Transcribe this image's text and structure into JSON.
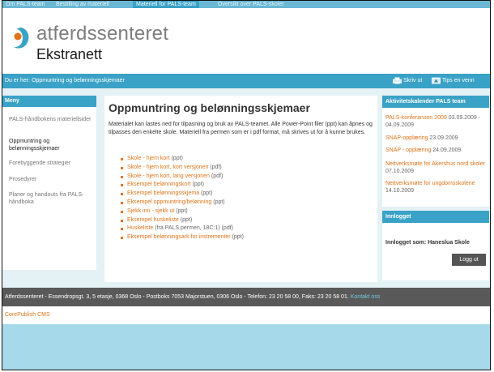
{
  "topnav": {
    "items": [
      {
        "label": "Om PALS-team"
      },
      {
        "label": "Bestilling av materiell"
      },
      {
        "label": "Materiell for PALS-team"
      },
      {
        "label": "Oversikt over PALS-skoler"
      }
    ]
  },
  "header": {
    "brand": "atferdssenteret",
    "subtitle": "Ekstranett"
  },
  "breadcrumb": {
    "prefix": "Du er her: ",
    "link": "Oppmuntring og belønningsskjemaer"
  },
  "tools": {
    "print_label": "Skriv ut",
    "tip_label": "Tips en venn"
  },
  "sidebar": {
    "heading": "Meny",
    "items": [
      {
        "label": "PALS-håndbokens materiellsider"
      },
      {
        "label": "Oppmuntring og belønningsskjemaer"
      },
      {
        "label": "Forebyggende strategier"
      },
      {
        "label": "Prosedyrer"
      },
      {
        "label": "Planer og handouts fra PALS-håndboka"
      }
    ]
  },
  "main": {
    "title": "Oppmuntring og belønningsskjemaer",
    "intro": "Materialet kan lastes ned for tilpasning og bruk av PALS-teamet. Alle Power-Point filer (ppt) kan åpnes og tilpasses den enkelte skole. Materiell fra permen som er i pdf format, må skrives ut for å kunne brukes.",
    "links": [
      {
        "text": "Skole - hjem kort",
        "suffix": " (ppt)"
      },
      {
        "text": "Skole - hjem kort, kort versjonen",
        "suffix": " (pdf)"
      },
      {
        "text": "Skole - hjem kort, lang versjonen",
        "suffix": " (pdf)"
      },
      {
        "text": "Eksempel belønningskort",
        "suffix": " (ppt)"
      },
      {
        "text": "Eksempel belønningsskjema",
        "suffix": " (ppt)"
      },
      {
        "text": "Eksempel oppmuntring/belønning",
        "suffix": " (ppt)"
      },
      {
        "text": "Sjekk inn - sjekk ut",
        "suffix": " (ppt)"
      },
      {
        "text": "Eksempel huskeliste",
        "suffix": " (ppt)"
      },
      {
        "text": "Huskeliste",
        "suffix": " (fra PALS permen, 18C:1) (pdf)"
      },
      {
        "text": "Eksempel belønningsark for instrementer",
        "suffix": " (ppt)"
      }
    ]
  },
  "calendar": {
    "heading": "Aktivitetskalender PALS team",
    "items": [
      {
        "link": "PALS-konferansen 2009",
        "date": " 03.09.2009 - 04.09.2009"
      },
      {
        "link": "SNAP-opplæring",
        "date": " 23.09.2009"
      },
      {
        "link": "SNAP - opplæring",
        "date": " 24.09.2009"
      },
      {
        "link": "Nettverksmøte for Akershus nord skoler",
        "date": " 07.10.2009"
      },
      {
        "link": "Nettverksmøte for ungdomsskolene",
        "date": " 14.10.2009"
      }
    ]
  },
  "login": {
    "heading": "Innlogget",
    "status": "Innlogget som: Haneslua Skole",
    "logout_label": "Logg ut"
  },
  "footer": {
    "text": "Atferdssenteret - Essendropsgt. 3, 5 etasje, 0368 Oslo - Postboks 7053 Majorstuen, 0306 Oslo - Telefon: 23 20 58 00, Faks: 23 20 58 01.",
    "contact_label": "Kontakt oss",
    "cms_label": "CorePublish CMS"
  },
  "colors": {
    "accent": "#3aa2c6",
    "link": "#e0741a",
    "background": "#a6d9e9",
    "footer": "#595959"
  }
}
